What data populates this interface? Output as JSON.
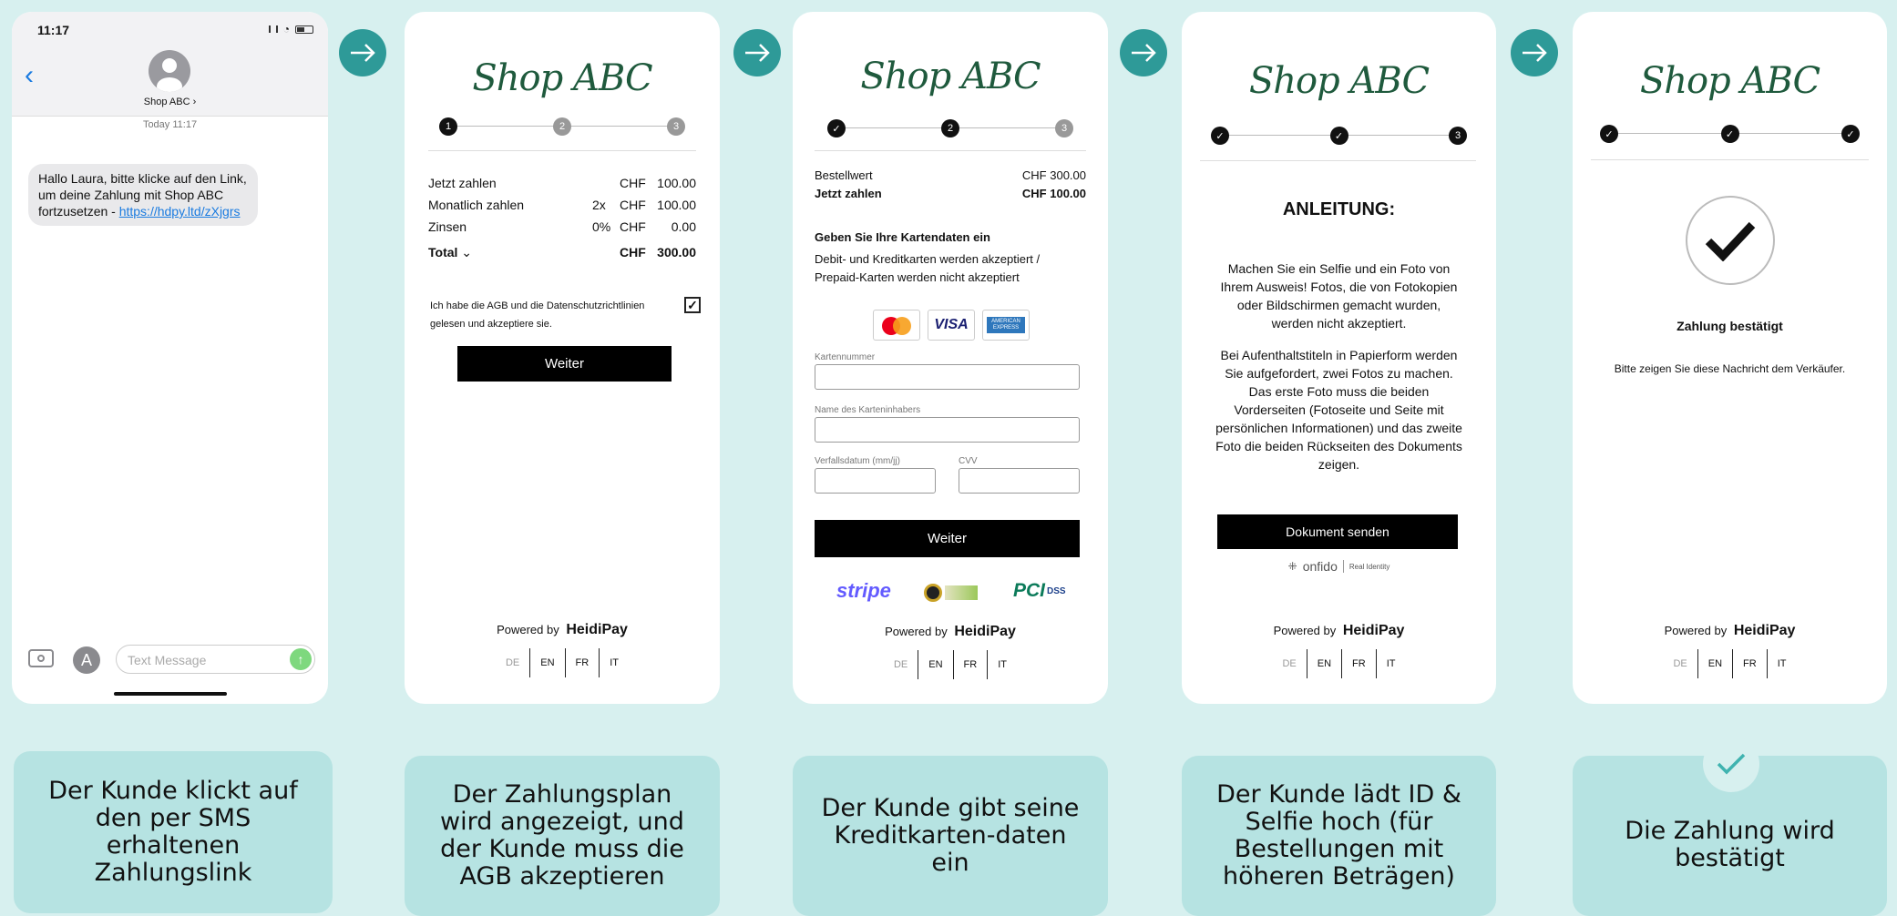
{
  "phone": {
    "time": "11:17",
    "contact": "Shop ABC",
    "date_line": "Today 11:17",
    "message_text": "Hallo Laura, bitte klicke auf den Link, um deine Zahlung mit Shop ABC fortzusetzen - ",
    "message_link": "https://hdpy.ltd/zXjgrs",
    "input_placeholder": "Text Message"
  },
  "logo_text": "Shop ABC",
  "powered_by": "Powered by",
  "brand": "HeidiPay",
  "langs": [
    "DE",
    "EN",
    "FR",
    "IT"
  ],
  "screen2": {
    "steps": [
      "1",
      "2",
      "3"
    ],
    "rows": [
      {
        "label": "Jetzt zahlen",
        "qty": "",
        "cur": "CHF",
        "amount": "100.00"
      },
      {
        "label": "Monatlich zahlen",
        "qty": "2x",
        "cur": "CHF",
        "amount": "100.00"
      },
      {
        "label": "Zinsen",
        "qty": "0%",
        "cur": "CHF",
        "amount": "0.00"
      }
    ],
    "total_label": "Total",
    "total_cur": "CHF",
    "total_amount": "300.00",
    "consent": "Ich habe die AGB und die Datenschutzrichtlinien gelesen und akzeptiere sie.",
    "button": "Weiter"
  },
  "screen3": {
    "steps": [
      "",
      "2",
      "3"
    ],
    "order_label": "Bestellwert",
    "order_value": "CHF 300.00",
    "now_label": "Jetzt zahlen",
    "now_value": "CHF 100.00",
    "heading": "Geben Sie Ihre Kartendaten ein",
    "subtext": "Debit- und Kreditkarten werden akzeptiert / Prepaid-Karten werden nicht akzeptiert",
    "cards": [
      "VISA",
      "AMERICAN EXPRESS"
    ],
    "card_number_label": "Kartennummer",
    "holder_label": "Name des Karteninhabers",
    "expiry_label": "Verfallsdatum (mm/jj)",
    "cvv_label": "CVV",
    "button": "Weiter",
    "stripe": "stripe",
    "pci": "PCI",
    "dss": "DSS"
  },
  "screen4": {
    "steps": [
      "",
      "",
      "3"
    ],
    "heading": "ANLEITUNG:",
    "para1": "Machen Sie ein Selfie und ein Foto von Ihrem Ausweis! Fotos, die von Fotokopien oder Bildschirmen gemacht wurden, werden nicht akzeptiert.",
    "para2": "Bei Aufenthaltstiteln in Papierform werden Sie aufgefordert, zwei Fotos zu machen. Das erste Foto muss die beiden Vorderseiten (Fotoseite und Seite mit persönlichen Informationen) und das zweite Foto die beiden Rückseiten des Dokuments zeigen.",
    "button": "Dokument senden",
    "onfido": "onfido",
    "onfido_tag": "Real Identity"
  },
  "screen5": {
    "title": "Zahlung bestätigt",
    "subtitle": "Bitte zeigen Sie diese Nachricht dem Verkäufer."
  },
  "captions": [
    "Der Kunde klickt auf den per SMS erhaltenen Zahlungslink",
    "Der Zahlungsplan wird angezeigt, und der Kunde muss die AGB akzeptieren",
    "Der Kunde gibt seine Kreditkarten-daten ein",
    "Der Kunde lädt ID & Selfie hoch (für Bestellungen mit höheren Beträgen)",
    "Die Zahlung wird bestätigt"
  ],
  "colors": {
    "background": "#d7f0ef",
    "caption": "#b6e3e2",
    "arrow": "#2e9a98",
    "logo": "#1f5a3d",
    "link": "#1a7be0"
  }
}
